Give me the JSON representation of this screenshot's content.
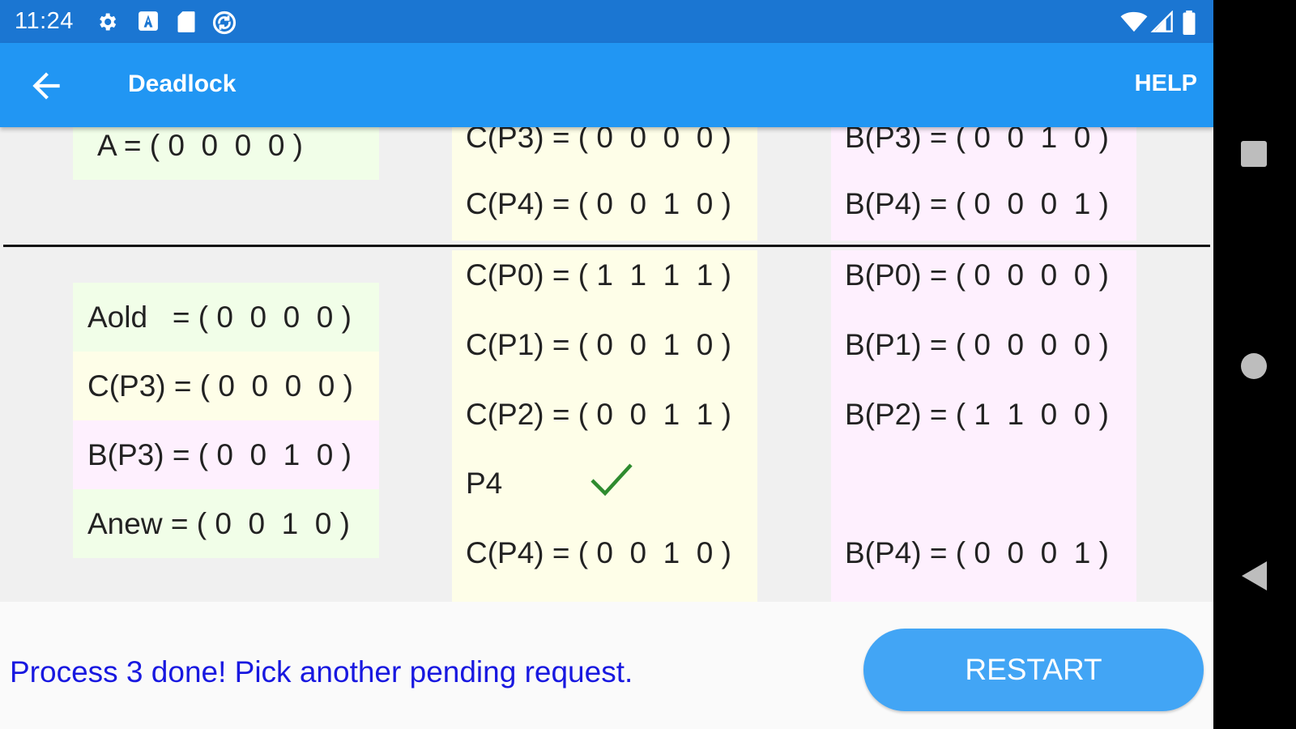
{
  "status_bar": {
    "time": "11:24",
    "icons": [
      "gear-icon",
      "a-icon",
      "sd-card-icon",
      "sync-icon",
      "wifi-icon",
      "signal-icon",
      "battery-icon"
    ]
  },
  "app_bar": {
    "title": "Deadlock",
    "help_label": "HELP",
    "back_icon": "arrow-left-icon"
  },
  "top_section": {
    "a_row": "A = ( 0  0  0  0 )",
    "c_rows": [
      "C(P3) = ( 0  0  0  0 )",
      "C(P4) = ( 0  0  1  0 )"
    ],
    "b_rows": [
      "B(P3) = ( 0  0  1  0 )",
      "B(P4) = ( 0  0  0  1 )"
    ]
  },
  "step": {
    "aold": "Aold   = ( 0  0  0  0 )",
    "c_p3": "C(P3) = ( 0  0  0  0 )",
    "b_p3": "B(P3) = ( 0  0  1  0 )",
    "anew": "Anew = ( 0  0  1  0 )",
    "c_rows": [
      "C(P0) = ( 1  1  1  1 )",
      "C(P1) = ( 0  0  1  0 )",
      "C(P2) = ( 0  0  1  1 )"
    ],
    "p4_label": "P4",
    "p4_status_icon": "checkmark-icon",
    "c_p4": "C(P4) = ( 0  0  1  0 )",
    "b_rows": [
      "B(P0) = ( 0  0  0  0 )",
      "B(P1) = ( 0  0  0  0 )",
      "B(P2) = ( 1  1  0  0 )"
    ],
    "b_p4": "B(P4) = ( 0  0  0  1 )"
  },
  "footer": {
    "message": "Process 3 done! Pick another pending request.",
    "restart_label": "RESTART"
  },
  "nav_bar": {
    "icons": [
      "recents-square-icon",
      "home-circle-icon",
      "back-triangle-icon"
    ]
  },
  "colors": {
    "status_bar": "#1b76d2",
    "app_bar": "#2196f3",
    "restart_button": "#42a5f5",
    "message_text": "#1818e0",
    "available_bg": "#f1fee8",
    "current_bg": "#fefee8",
    "requested_bg": "#fef0fe",
    "check": "#2e8b2e"
  }
}
